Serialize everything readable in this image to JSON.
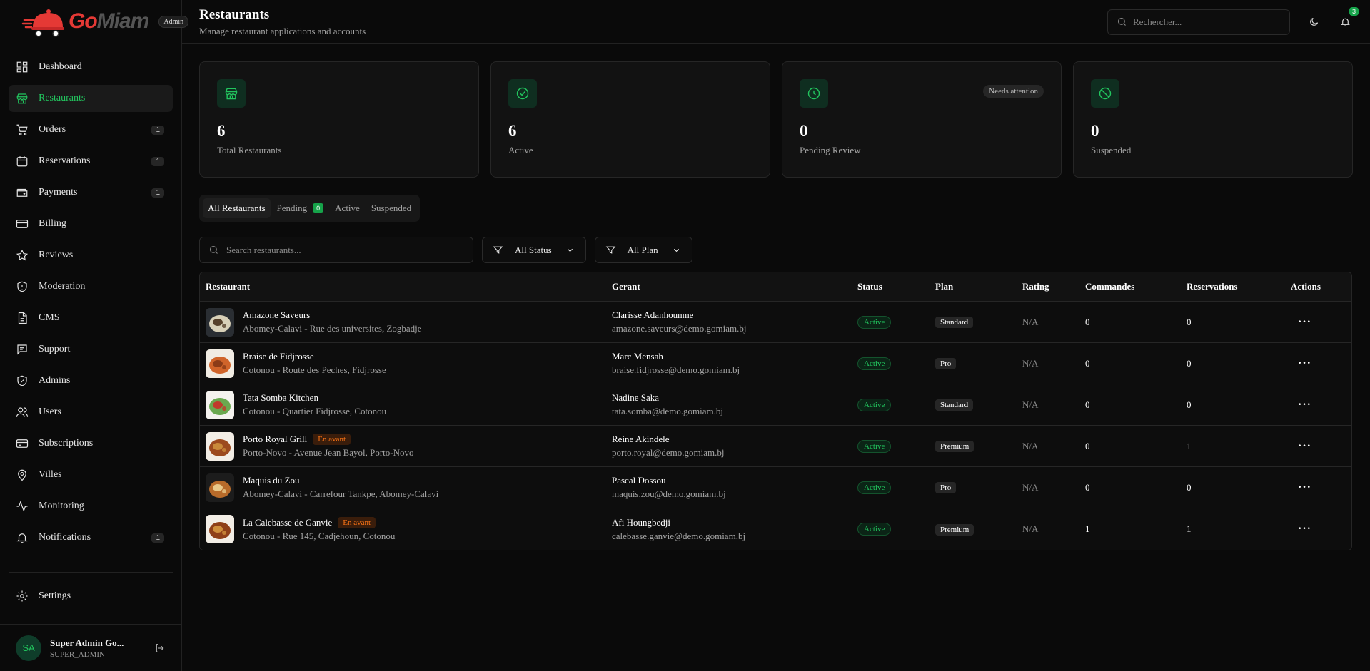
{
  "brand": {
    "logo_go": "Go",
    "logo_miam": "Miam",
    "badge": "Admin"
  },
  "sidebar": {
    "items": [
      {
        "label": "Dashboard",
        "icon": "dashboard-icon",
        "count": ""
      },
      {
        "label": "Restaurants",
        "icon": "store-icon",
        "count": "",
        "active": true
      },
      {
        "label": "Orders",
        "icon": "cart-icon",
        "count": "1"
      },
      {
        "label": "Reservations",
        "icon": "calendar-icon",
        "count": "1"
      },
      {
        "label": "Payments",
        "icon": "wallet-icon",
        "count": "1"
      },
      {
        "label": "Billing",
        "icon": "card-icon",
        "count": ""
      },
      {
        "label": "Reviews",
        "icon": "star-icon",
        "count": ""
      },
      {
        "label": "Moderation",
        "icon": "shield-alert-icon",
        "count": ""
      },
      {
        "label": "CMS",
        "icon": "file-icon",
        "count": ""
      },
      {
        "label": "Support",
        "icon": "message-icon",
        "count": ""
      },
      {
        "label": "Admins",
        "icon": "shield-check-icon",
        "count": ""
      },
      {
        "label": "Users",
        "icon": "users-icon",
        "count": ""
      },
      {
        "label": "Subscriptions",
        "icon": "subscription-icon",
        "count": ""
      },
      {
        "label": "Villes",
        "icon": "map-pin-icon",
        "count": ""
      },
      {
        "label": "Monitoring",
        "icon": "activity-icon",
        "count": ""
      },
      {
        "label": "Notifications",
        "icon": "bell-icon",
        "count": "1"
      }
    ],
    "settings_label": "Settings",
    "user": {
      "initials": "SA",
      "name": "Super Admin Go...",
      "role": "SUPER_ADMIN"
    }
  },
  "header": {
    "title": "Restaurants",
    "subtitle": "Manage restaurant applications and accounts",
    "search_placeholder": "Rechercher...",
    "notif_count": "3"
  },
  "stats": [
    {
      "value": "6",
      "label": "Total Restaurants",
      "icon": "store-icon"
    },
    {
      "value": "6",
      "label": "Active",
      "icon": "check-circle-icon"
    },
    {
      "value": "0",
      "label": "Pending Review",
      "icon": "clock-icon",
      "tag": "Needs attention"
    },
    {
      "value": "0",
      "label": "Suspended",
      "icon": "ban-icon"
    }
  ],
  "tabs": {
    "all": "All Restaurants",
    "pending": "Pending",
    "pending_count": "0",
    "active": "Active",
    "suspended": "Suspended"
  },
  "filters": {
    "search_placeholder": "Search restaurants...",
    "status": "All Status",
    "plan": "All Plan"
  },
  "table": {
    "headers": [
      "Restaurant",
      "Gerant",
      "Status",
      "Plan",
      "Rating",
      "Commandes",
      "Reservations",
      "Actions"
    ],
    "rows": [
      {
        "name": "Amazone Saveurs",
        "featured": "",
        "address": "Abomey-Calavi - Rue des universites, Zogbadje",
        "manager": "Clarisse Adanhounme",
        "email": "amazone.saveurs@demo.gomiam.bj",
        "status": "Active",
        "plan": "Standard",
        "rating": "N/A",
        "orders": "0",
        "reservations": "0",
        "thumb": [
          "#2a2e33",
          "#d8d0b8",
          "#56402a"
        ]
      },
      {
        "name": "Braise de Fidjrosse",
        "featured": "",
        "address": "Cotonou - Route des Peches, Fidjrosse",
        "manager": "Marc Mensah",
        "email": "braise.fidjrosse@demo.gomiam.bj",
        "status": "Active",
        "plan": "Pro",
        "rating": "N/A",
        "orders": "0",
        "reservations": "0",
        "thumb": [
          "#f1ece3",
          "#d0642a",
          "#8a3b17"
        ]
      },
      {
        "name": "Tata Somba Kitchen",
        "featured": "",
        "address": "Cotonou - Quartier Fidjrosse, Cotonou",
        "manager": "Nadine Saka",
        "email": "tata.somba@demo.gomiam.bj",
        "status": "Active",
        "plan": "Standard",
        "rating": "N/A",
        "orders": "0",
        "reservations": "0",
        "thumb": [
          "#f4f2ee",
          "#6aa84f",
          "#c0392b"
        ]
      },
      {
        "name": "Porto Royal Grill",
        "featured": "En avant",
        "address": "Porto-Novo - Avenue Jean Bayol, Porto-Novo",
        "manager": "Reine Akindele",
        "email": "porto.royal@demo.gomiam.bj",
        "status": "Active",
        "plan": "Premium",
        "rating": "N/A",
        "orders": "0",
        "reservations": "1",
        "thumb": [
          "#f3eee6",
          "#9c4a1e",
          "#c98a3a"
        ]
      },
      {
        "name": "Maquis du Zou",
        "featured": "",
        "address": "Abomey-Calavi - Carrefour Tankpe, Abomey-Calavi",
        "manager": "Pascal Dossou",
        "email": "maquis.zou@demo.gomiam.bj",
        "status": "Active",
        "plan": "Pro",
        "rating": "N/A",
        "orders": "0",
        "reservations": "0",
        "thumb": [
          "#1c1c1c",
          "#b86b2a",
          "#e9c98a"
        ]
      },
      {
        "name": "La Calebasse de Ganvie",
        "featured": "En avant",
        "address": "Cotonou - Rue 145, Cadjehoun, Cotonou",
        "manager": "Afi Houngbedji",
        "email": "calebasse.ganvie@demo.gomiam.bj",
        "status": "Active",
        "plan": "Premium",
        "rating": "N/A",
        "orders": "1",
        "reservations": "1",
        "thumb": [
          "#f3eee6",
          "#8f3f18",
          "#cf8e3c"
        ]
      }
    ]
  },
  "colors": {
    "accent": "#22c55e",
    "brand_red": "#e53935",
    "featured": "#f97316",
    "background": "#0a0a0a"
  }
}
